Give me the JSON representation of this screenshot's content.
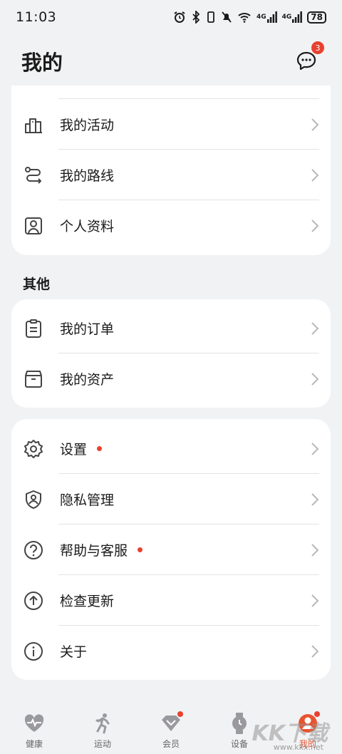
{
  "status_bar": {
    "time": "11:03",
    "battery": "78",
    "network_1": "4G",
    "network_2": "4G",
    "wifi_label": "6"
  },
  "header": {
    "title": "我的",
    "message_badge": "3"
  },
  "card1": {
    "items": [
      {
        "label": "我的活动",
        "icon": "activity-icon"
      },
      {
        "label": "我的路线",
        "icon": "route-icon"
      },
      {
        "label": "个人资料",
        "icon": "profile-icon"
      }
    ]
  },
  "section_other": {
    "title": "其他"
  },
  "card2": {
    "items": [
      {
        "label": "我的订单",
        "icon": "order-icon"
      },
      {
        "label": "我的资产",
        "icon": "assets-icon"
      }
    ]
  },
  "card3": {
    "items": [
      {
        "label": "设置",
        "icon": "settings-icon",
        "dot": true
      },
      {
        "label": "隐私管理",
        "icon": "privacy-icon",
        "dot": false
      },
      {
        "label": "帮助与客服",
        "icon": "help-icon",
        "dot": true
      },
      {
        "label": "检查更新",
        "icon": "update-icon",
        "dot": false
      },
      {
        "label": "关于",
        "icon": "about-icon",
        "dot": false
      }
    ]
  },
  "tabbar": {
    "tabs": [
      {
        "label": "健康",
        "icon": "health-icon"
      },
      {
        "label": "运动",
        "icon": "exercise-icon"
      },
      {
        "label": "会员",
        "icon": "member-icon"
      },
      {
        "label": "设备",
        "icon": "device-icon"
      },
      {
        "label": "我的",
        "icon": "me-icon"
      }
    ]
  },
  "watermark": {
    "text": "KK下载",
    "url": "www.kkx.net"
  },
  "colors": {
    "background": "#f1f2f4",
    "card": "#ffffff",
    "accent": "#e8542f",
    "badge": "#e8412f"
  }
}
